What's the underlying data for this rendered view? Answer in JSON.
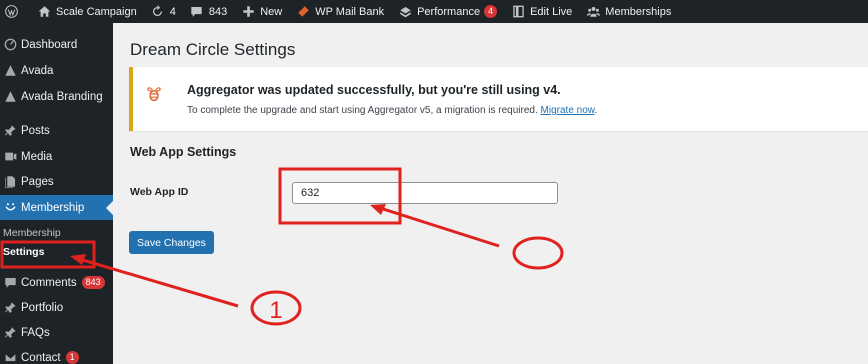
{
  "admin_bar": {
    "site_name": "Scale Campaign",
    "updates_count": "4",
    "comments_count": "843",
    "new_label": "New",
    "wp_mail_bank_label": "WP Mail Bank",
    "performance_label": "Performance",
    "performance_badge": "4",
    "edit_live_label": "Edit Live",
    "memberships_label": "Memberships"
  },
  "sidebar": {
    "dashboard": "Dashboard",
    "avada": "Avada",
    "avada_branding": "Avada Branding",
    "posts": "Posts",
    "media": "Media",
    "pages": "Pages",
    "membership": "Membership",
    "submenu_heading": "Membership",
    "submenu_settings": "Settings",
    "comments": "Comments",
    "comments_badge": "843",
    "portfolio": "Portfolio",
    "faqs": "FAQs",
    "contact": "Contact",
    "contact_badge": "1"
  },
  "main": {
    "page_title": "Dream Circle Settings",
    "notice": {
      "title": "Aggregator was updated successfully, but you're still using v4.",
      "text": "To complete the upgrade and start using Aggregator v5, a migration is required.",
      "link_text": "Migrate now",
      "trailing": "."
    },
    "section_title": "Web App Settings",
    "web_app_id_label": "Web App ID",
    "web_app_id_value": "632",
    "save_button": "Save Changes"
  },
  "annotations": {
    "marker_1": "1",
    "color": "#e0221f"
  }
}
